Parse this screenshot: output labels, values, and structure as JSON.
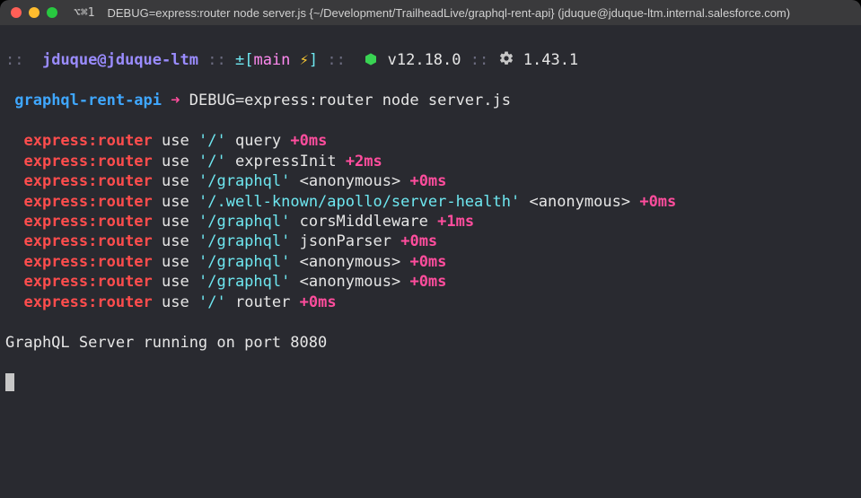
{
  "window": {
    "title_icon": "⌥⌘1",
    "title": "DEBUG=express:router node server.js {~/Development/TrailheadLive/graphql-rent-api} (jduque@jduque-ltm.internal.salesforce.com)"
  },
  "status": {
    "sep": "::",
    "userhost": "jduque@jduque-ltm",
    "pm": "±",
    "lbr": "[",
    "branch": "main",
    "rbr": "]",
    "bolt": "⚡",
    "node_version": "v12.18.0",
    "tool_version": "1.43.1"
  },
  "prompt": {
    "cwd": "graphql-rent-api",
    "arrow": "➜",
    "command": "DEBUG=express:router node server.js"
  },
  "log_lines": [
    {
      "mod": "express:router",
      "verb": "use",
      "path": "'/'",
      "mw": "query",
      "t": "+0ms"
    },
    {
      "mod": "express:router",
      "verb": "use",
      "path": "'/'",
      "mw": "expressInit",
      "t": "+2ms"
    },
    {
      "mod": "express:router",
      "verb": "use",
      "path": "'/graphql'",
      "mw": "<anonymous>",
      "t": "+0ms"
    },
    {
      "mod": "express:router",
      "verb": "use",
      "path": "'/.well-known/apollo/server-health'",
      "mw": "<anonymous>",
      "t": "+0ms"
    },
    {
      "mod": "express:router",
      "verb": "use",
      "path": "'/graphql'",
      "mw": "corsMiddleware",
      "t": "+1ms"
    },
    {
      "mod": "express:router",
      "verb": "use",
      "path": "'/graphql'",
      "mw": "jsonParser",
      "t": "+0ms"
    },
    {
      "mod": "express:router",
      "verb": "use",
      "path": "'/graphql'",
      "mw": "<anonymous>",
      "t": "+0ms"
    },
    {
      "mod": "express:router",
      "verb": "use",
      "path": "'/graphql'",
      "mw": "<anonymous>",
      "t": "+0ms"
    },
    {
      "mod": "express:router",
      "verb": "use",
      "path": "'/'",
      "mw": "router",
      "t": "+0ms"
    }
  ],
  "final": "GraphQL Server running on port 8080"
}
